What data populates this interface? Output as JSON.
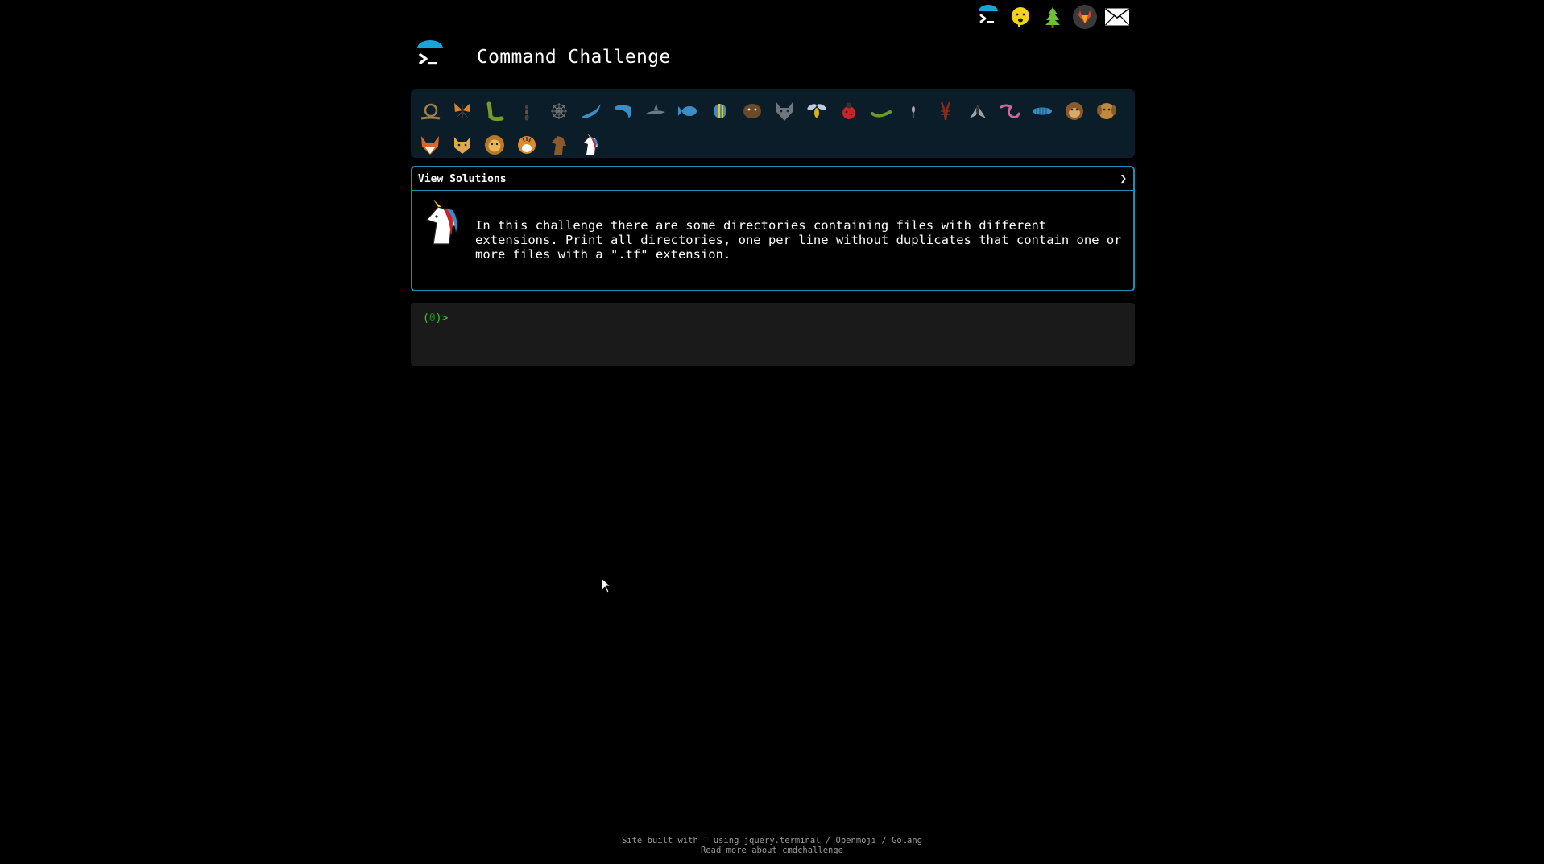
{
  "header": {
    "title": "Command Challenge"
  },
  "topnav": {
    "items": [
      {
        "name": "cmdchallenge-logo-link"
      },
      {
        "name": "sponsor-link"
      },
      {
        "name": "tree-link"
      },
      {
        "name": "gitlab-link"
      },
      {
        "name": "mail-link"
      }
    ]
  },
  "challenges": {
    "row1": [
      "snail",
      "butterfly",
      "caterpillar",
      "ant",
      "spider-web",
      "bird",
      "dolphin",
      "shark",
      "fish",
      "tropical-fish",
      "beaver",
      "wolf",
      "bee",
      "ladybug",
      "worm",
      "mosquito",
      "scorpion",
      "fly",
      "snake",
      "pill-bug",
      "monkey",
      "dog"
    ],
    "row2": [
      "fox",
      "cat",
      "lion",
      "tiger",
      "horse",
      "unicorn"
    ],
    "active": "unicorn"
  },
  "panel": {
    "toggle_label": "View Solutions",
    "chevron": "❯",
    "description": "In this challenge there are some directories containing files with different extensions. Print all directories, one per line without duplicates that contain one or more files with a \".tf\" extension."
  },
  "terminal": {
    "prompt_open": "(",
    "prompt_num": "0",
    "prompt_close": ")>"
  },
  "footer": {
    "line1_prefix": "Site built with",
    "heart": "♡",
    "line1_using": "using",
    "link_terminal": "jquery.terminal",
    "sep": "/",
    "link_openmoji": "Openmoji",
    "link_golang": "Golang",
    "line2_prefix": "Read more about",
    "link_cmdchallenge": "cmdchallenge"
  },
  "colors": {
    "background": "#000000",
    "accent": "#1b8fb6",
    "icon_bar_bg": "#0b1d28",
    "terminal_bg": "#1a1a1a",
    "prompt_green": "#33cc33"
  }
}
